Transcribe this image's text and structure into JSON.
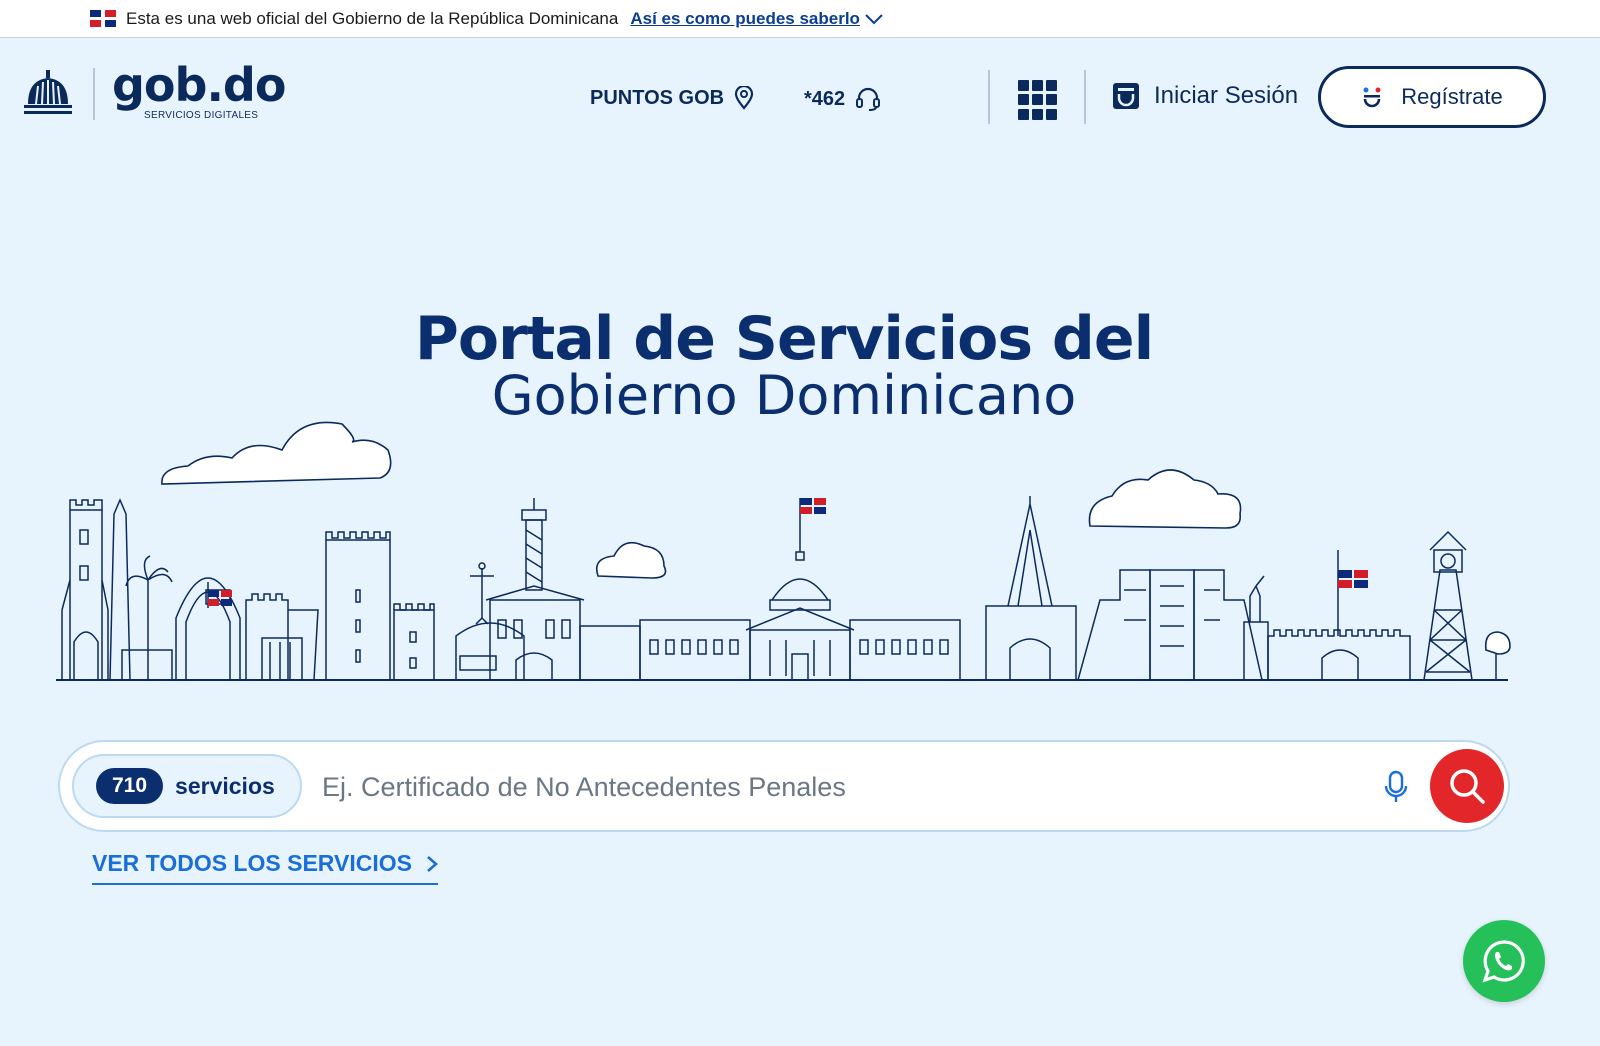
{
  "official_banner": {
    "text": "Esta es una web oficial del Gobierno de la República Dominicana",
    "link_label": "Así es como puedes saberlo"
  },
  "header": {
    "logo_text": "gob.do",
    "logo_subtitle": "SERVICIOS DIGITALES",
    "puntos_label": "PUNTOS GOB",
    "phone_label": "*462",
    "login_label": "Iniciar Sesión",
    "register_label": "Regístrate"
  },
  "hero": {
    "title": "Portal de Servicios del",
    "subtitle": "Gobierno Dominicano"
  },
  "search": {
    "count": "710",
    "count_label": "servicios",
    "placeholder": "Ej. Certificado de No Antecedentes Penales"
  },
  "links": {
    "all_services": "VER TODOS LOS SERVICIOS"
  },
  "colors": {
    "brand_navy": "#0b2a5c",
    "accent_red": "#e3262a",
    "link_blue": "#1a6ed8",
    "whatsapp_green": "#25c05a",
    "page_background": "#e8f4fd"
  },
  "icons": [
    "dr-flag-icon",
    "chevron-down-icon",
    "national-shield-icon",
    "location-pin-icon",
    "headset-icon",
    "apps-grid-icon",
    "user-badge-icon",
    "smile-icon",
    "microphone-icon",
    "search-icon",
    "chevron-right-icon",
    "whatsapp-icon"
  ]
}
